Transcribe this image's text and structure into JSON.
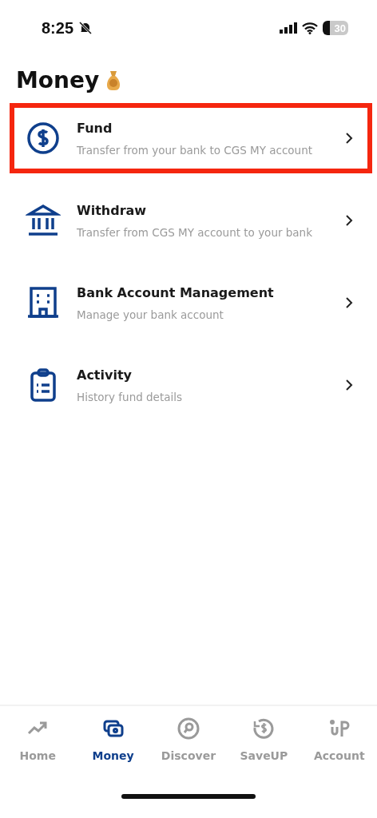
{
  "status_bar": {
    "time": "8:25",
    "muted": true,
    "battery": "30"
  },
  "title": "Money",
  "items": [
    {
      "kind": "dollar",
      "title": "Fund",
      "subtitle": "Transfer from your bank to CGS MY account",
      "highlighted": true
    },
    {
      "kind": "bank",
      "title": "Withdraw",
      "subtitle": "Transfer from CGS MY account to your bank",
      "highlighted": false
    },
    {
      "kind": "building",
      "title": "Bank Account Management",
      "subtitle": "Manage your bank account",
      "highlighted": false
    },
    {
      "kind": "clipboard",
      "title": "Activity",
      "subtitle": "History fund details",
      "highlighted": false
    }
  ],
  "tabs": [
    {
      "kind": "home",
      "label": "Home",
      "selected": false
    },
    {
      "kind": "money",
      "label": "Money",
      "selected": true
    },
    {
      "kind": "discover",
      "label": "Discover",
      "selected": false
    },
    {
      "kind": "saveup",
      "label": "SaveUP",
      "selected": false
    },
    {
      "kind": "account",
      "label": "Account",
      "selected": false
    }
  ]
}
